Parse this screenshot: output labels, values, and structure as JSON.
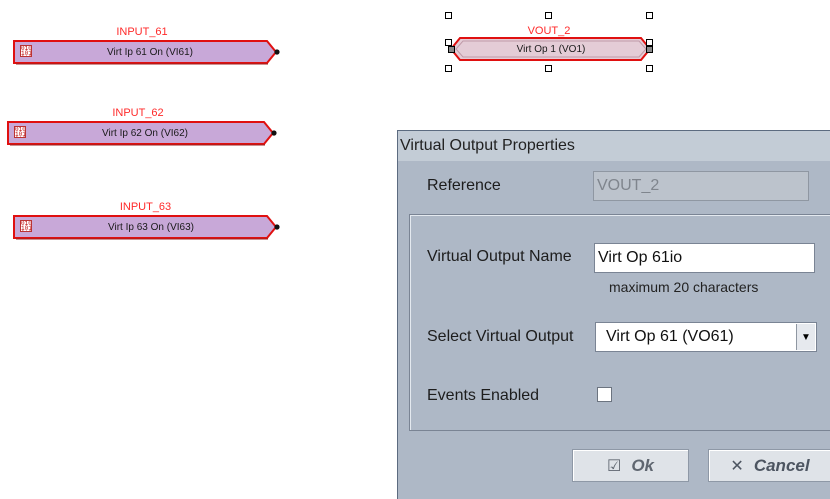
{
  "canvas": {
    "blocks": [
      {
        "title": "INPUT_61",
        "label": "Virt Ip 61 On (VI61)",
        "icon": "io-icon"
      },
      {
        "title": "INPUT_62",
        "label": "Virt Ip 62 On (VI62)",
        "icon": "io-icon"
      },
      {
        "title": "INPUT_63",
        "label": "Virt Ip 63 On (VI63)",
        "icon": "io-icon"
      }
    ],
    "output_block": {
      "title": "VOUT_2",
      "label": "Virt Op 1 (VO1)",
      "selected": true
    }
  },
  "dialog": {
    "title": "Virtual Output Properties",
    "reference_label": "Reference",
    "reference_value": "VOUT_2",
    "name_label": "Virtual Output Name",
    "name_value": "Virt Op 61io",
    "name_hint": "maximum 20 characters",
    "select_label": "Select Virtual Output",
    "select_value": "Virt Op 61 (VO61)",
    "events_label": "Events Enabled",
    "events_enabled": false,
    "ok_label": "Ok",
    "cancel_label": "Cancel"
  },
  "colors": {
    "block_fill": "#c8a8d8",
    "block_border": "#e01010",
    "title_red": "#ff2a2a",
    "dialog_bg": "#aeb8c6"
  }
}
